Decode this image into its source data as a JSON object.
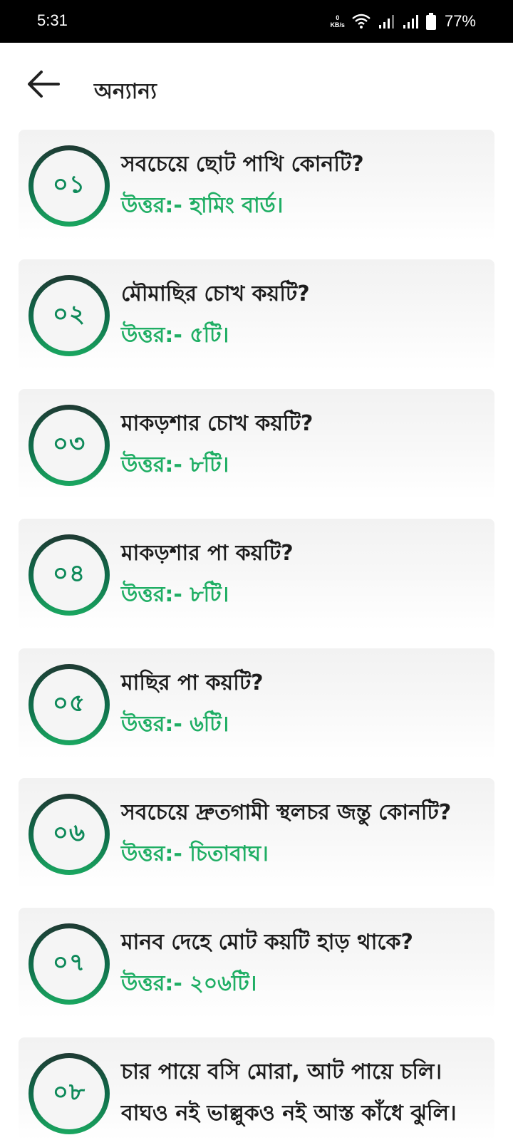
{
  "status_bar": {
    "time": "5:31",
    "net_speed_value": "0",
    "net_speed_unit": "KB/s",
    "battery_percent": "77%"
  },
  "app_bar": {
    "title": "অন্যান্য"
  },
  "items": [
    {
      "num": "০১",
      "question": "সবচেয়ে ছোট পাখি কোনটি?",
      "answer": "উত্তর:- হামিং বার্ড।"
    },
    {
      "num": "০২",
      "question": "মৌমাছির চোখ কয়টি?",
      "answer": "উত্তর:- ৫টি।"
    },
    {
      "num": "০৩",
      "question": "মাকড়শার চোখ কয়টি?",
      "answer": "উত্তর:- ৮টি।"
    },
    {
      "num": "০৪",
      "question": "মাকড়শার পা কয়টি?",
      "answer": "উত্তর:- ৮টি।"
    },
    {
      "num": "০৫",
      "question": "মাছির পা কয়টি?",
      "answer": "উত্তর:- ৬টি।"
    },
    {
      "num": "০৬",
      "question": "সবচেয়ে দ্রুতগামী স্থলচর জন্তু কোনটি?",
      "answer": "উত্তর:- চিতাবাঘ।"
    },
    {
      "num": "০৭",
      "question": "মানব দেহে মোট কয়টি হাড় থাকে?",
      "answer": "উত্তর:- ২০৬টি।"
    },
    {
      "num": "০৮",
      "question": "চার পায়ে বসি মোরা, আট পায়ে চলি।",
      "answer": "বাঘও নই ভাল্লুকও নই আস্ত কাঁধে ঝুলি।"
    }
  ]
}
